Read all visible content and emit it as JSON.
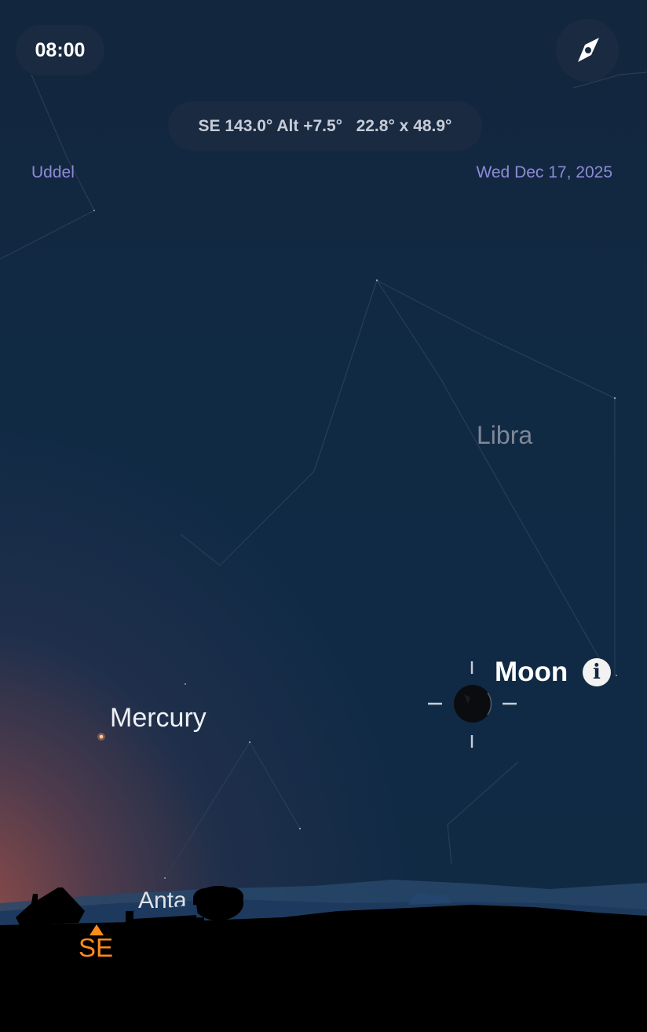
{
  "time": "08:00",
  "view_info": "SE 143.0° Alt +7.5°   22.8° x 48.9°",
  "location": "Uddel",
  "date": "Wed Dec 17, 2025",
  "constellation_label": "Libra",
  "planet_label": "Mercury",
  "selected_object": "Moon",
  "star_label": "Anta",
  "direction_marker": "SE",
  "icons": {
    "compass": "compass-icon",
    "info": "info-icon"
  },
  "colors": {
    "accent_orange": "#ff8c1a",
    "corner_text": "#8e8ad8"
  }
}
